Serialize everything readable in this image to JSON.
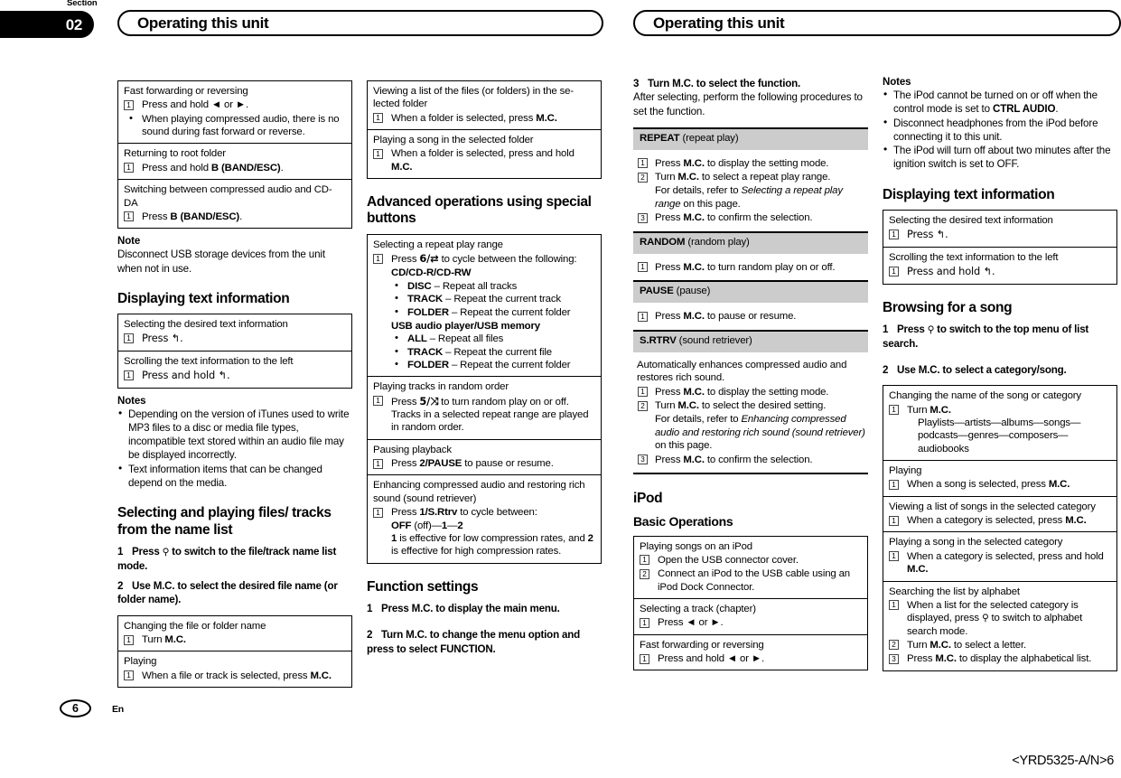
{
  "page": {
    "section_word": "Section",
    "section_number": "02",
    "running_head_left": "Operating this unit",
    "running_head_right": "Operating this unit",
    "page_number": "6",
    "language_code": "En",
    "document_id": "<YRD5325-A/N>6"
  },
  "col1": {
    "table1": {
      "rows": [
        {
          "title": "Fast forwarding or reversing",
          "step": "Press and hold ◄ or ►.",
          "bullet": "When playing compressed audio, there is no sound during fast forward or reverse."
        },
        {
          "title": "Returning to root folder",
          "step_prefix": "Press and hold ",
          "step_bold": "B (BAND/ESC)",
          "step_suffix": "."
        },
        {
          "title": "Switching between compressed audio and CD-DA",
          "step_prefix": "Press ",
          "step_bold": "B (BAND/ESC)",
          "step_suffix": "."
        }
      ]
    },
    "note_heading": "Note",
    "note_text": "Disconnect USB storage devices from the unit when not in use.",
    "heading_display_text": "Displaying text information",
    "table2": {
      "rows": [
        {
          "title": "Selecting the desired text information",
          "step": "Press ↰."
        },
        {
          "title": "Scrolling the text information to the left",
          "step": "Press and hold ↰."
        }
      ]
    },
    "notes_heading": "Notes",
    "notes": [
      "Depending on the version of iTunes used to write MP3 files to a disc or media file types, incompatible text stored within an audio file may be displayed incorrectly.",
      "Text information items that can be changed depend on the media."
    ],
    "heading_selecting": "Selecting and playing files/ tracks from the name list",
    "step1_num": "1",
    "step1_text_a": "Press",
    "step1_text_b": "to switch to the file/track name list mode.",
    "step2_num": "2",
    "step2_text": "Use M.C. to select the desired file name (or folder name).",
    "table3": {
      "rows": [
        {
          "title": "Changing the file or folder name",
          "step_prefix": "Turn ",
          "step_bold": "M.C."
        },
        {
          "title": "Playing",
          "step_prefix": "When a file or track is selected, press ",
          "step_bold": "M.C."
        }
      ]
    }
  },
  "col2": {
    "table1": {
      "rows": [
        {
          "title": "Viewing a list of the files (or folders) in the se-lected folder",
          "step_prefix": "When a folder is selected, press ",
          "step_bold": "M.C."
        },
        {
          "title": "Playing a song in the selected folder",
          "step_prefix": "When a folder is selected, press and hold ",
          "step_bold": "M.C."
        }
      ]
    },
    "heading_advanced": "Advanced operations using special buttons",
    "repeat_row": {
      "title": "Selecting a repeat play range",
      "step_prefix": "Press ",
      "step_button": "6/⇄",
      "step_suffix": " to cycle between the following:",
      "group1_label": "CD/CD-R/CD-RW",
      "group1_items": [
        {
          "bold": "DISC",
          "text": " – Repeat all tracks"
        },
        {
          "bold": "TRACK",
          "text": " – Repeat the current track"
        },
        {
          "bold": "FOLDER",
          "text": " – Repeat the current folder"
        }
      ],
      "group2_label": "USB audio player/USB memory",
      "group2_items": [
        {
          "bold": "ALL",
          "text": " – Repeat all files"
        },
        {
          "bold": "TRACK",
          "text": " – Repeat the current file"
        },
        {
          "bold": "FOLDER",
          "text": " – Repeat the current folder"
        }
      ]
    },
    "random_row": {
      "title": "Playing tracks in random order",
      "step_prefix": "Press ",
      "step_button": "5/⤨",
      "step_suffix": " to turn random play on or off.",
      "sub": "Tracks in a selected repeat range are played in random order."
    },
    "pause_row": {
      "title": "Pausing playback",
      "step_prefix": "Press ",
      "step_bold": "2/PAUSE",
      "step_suffix": " to pause or resume."
    },
    "srtrv_row": {
      "title": "Enhancing compressed audio and restoring rich sound (sound retriever)",
      "step_prefix": "Press ",
      "step_bold": "1/S.Rtrv",
      "step_suffix": " to cycle between:",
      "modes_a": "OFF",
      "modes_b": " (off)—",
      "modes_c": "1",
      "modes_d": "—",
      "modes_e": "2",
      "desc_a": "1",
      "desc_b": " is effective for low compression rates, and ",
      "desc_c": "2",
      "desc_d": " is effective for high compression rates."
    },
    "heading_function": "Function settings",
    "fstep1_num": "1",
    "fstep1_text": "Press M.C. to display the main menu.",
    "fstep2_num": "2",
    "fstep2_text": "Turn M.C. to change the menu option and press to select FUNCTION."
  },
  "col3": {
    "step3_num": "3",
    "step3_text": "Turn M.C. to select the function.",
    "step3_body": "After selecting, perform the following procedures to set the function.",
    "bands": [
      {
        "name": "REPEAT",
        "desc": " (repeat play)",
        "steps": [
          {
            "n": "1",
            "prefix": "Press ",
            "bold": "M.C.",
            "suffix": " to display the setting mode."
          },
          {
            "n": "2",
            "prefix": "Turn ",
            "bold": "M.C.",
            "suffix": " to select a repeat play range.",
            "sub_a": "For details, refer to ",
            "sub_i": "Selecting a repeat play range",
            "sub_b": " on this page."
          },
          {
            "n": "3",
            "prefix": "Press ",
            "bold": "M.C.",
            "suffix": " to confirm the selection."
          }
        ]
      },
      {
        "name": "RANDOM",
        "desc": " (random play)",
        "steps": [
          {
            "n": "1",
            "prefix": "Press ",
            "bold": "M.C.",
            "suffix": " to turn random play on or off."
          }
        ]
      },
      {
        "name": "PAUSE",
        "desc": " (pause)",
        "steps": [
          {
            "n": "1",
            "prefix": "Press ",
            "bold": "M.C.",
            "suffix": " to pause or resume."
          }
        ]
      },
      {
        "name": "S.RTRV",
        "desc": " (sound retriever)",
        "intro": "Automatically enhances compressed audio and restores rich sound.",
        "steps": [
          {
            "n": "1",
            "prefix": "Press ",
            "bold": "M.C.",
            "suffix": " to display the setting mode."
          },
          {
            "n": "2",
            "prefix": "Turn ",
            "bold": "M.C.",
            "suffix": " to select the desired setting.",
            "sub_a": "For details, refer to ",
            "sub_i": "Enhancing compressed audio and restoring rich sound (sound retriever)",
            "sub_b": " on this page."
          },
          {
            "n": "3",
            "prefix": "Press ",
            "bold": "M.C.",
            "suffix": " to confirm the selection."
          }
        ]
      }
    ],
    "heading_ipod": "iPod",
    "heading_basic": "Basic Operations",
    "table": {
      "rows": [
        {
          "title": "Playing songs on an iPod",
          "steps": [
            {
              "n": "1",
              "text": "Open the USB connector cover."
            },
            {
              "n": "2",
              "text": "Connect an iPod to the USB cable using an iPod Dock Connector."
            }
          ]
        },
        {
          "title": "Selecting a track (chapter)",
          "steps": [
            {
              "n": "1",
              "text": "Press ◄ or ►."
            }
          ]
        },
        {
          "title": "Fast forwarding or reversing",
          "steps": [
            {
              "n": "1",
              "text": "Press and hold ◄ or ►."
            }
          ]
        }
      ]
    }
  },
  "col4": {
    "notes_heading": "Notes",
    "notes": [
      {
        "a": "The iPod cannot be turned on or off when the control mode is set to ",
        "bold": "CTRL AUDIO",
        "b": "."
      },
      {
        "a": "Disconnect headphones from the iPod before connecting it to this unit.",
        "bold": "",
        "b": ""
      },
      {
        "a": "The iPod will turn off about two minutes after the ignition switch is set to OFF.",
        "bold": "",
        "b": ""
      }
    ],
    "heading_display_text": "Displaying text information",
    "table1": {
      "rows": [
        {
          "title": "Selecting the desired text information",
          "step": "Press ↰."
        },
        {
          "title": "Scrolling the text information to the left",
          "step": "Press and hold ↰."
        }
      ]
    },
    "heading_browsing": "Browsing for a song",
    "bstep1_num": "1",
    "bstep1_a": "Press",
    "bstep1_b": "to switch to the top menu of list search.",
    "bstep2_num": "2",
    "bstep2_text": "Use M.C. to select a category/song.",
    "table2": {
      "rows": [
        {
          "title": "Changing the name of the song or category",
          "step_prefix": "Turn ",
          "step_bold": "M.C.",
          "sub": "Playlists—artists—albums—songs—podcasts—genres—composers—audiobooks"
        },
        {
          "title": "Playing",
          "step_prefix": "When a song is selected, press ",
          "step_bold": "M.C."
        },
        {
          "title": "Viewing a list of songs in the selected category",
          "step_prefix": "When a category is selected, press ",
          "step_bold": "M.C."
        },
        {
          "title": "Playing a song in the selected category",
          "step_prefix": "When a category is selected, press and hold ",
          "step_bold": "M.C."
        },
        {
          "title": "Searching the list by alphabet",
          "steps": [
            {
              "n": "1",
              "a": "When a list for the selected category is displayed, press ",
              "icon": "search-icon",
              "b": " to switch to alphabet search mode."
            },
            {
              "n": "2",
              "a": "Turn ",
              "bold": "M.C.",
              "b": " to select a letter."
            },
            {
              "n": "3",
              "a": "Press ",
              "bold": "M.C.",
              "b": " to display the alphabetical list."
            }
          ]
        }
      ]
    }
  },
  "colors": {
    "band_gray": "#cccccc",
    "rule_black": "#000000"
  }
}
